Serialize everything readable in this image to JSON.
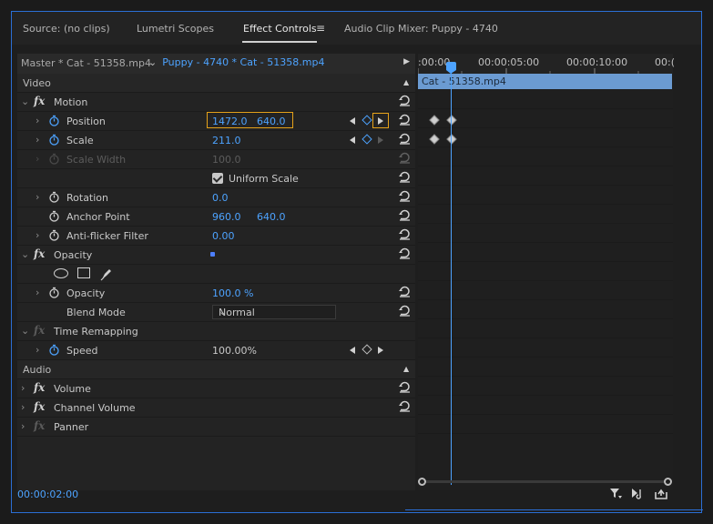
{
  "tabs": [
    {
      "label": "Source: (no clips)",
      "active": false
    },
    {
      "label": "Lumetri Scopes",
      "active": false
    },
    {
      "label": "Effect Controls",
      "active": true
    },
    {
      "label": "Audio Clip Mixer: Puppy - 4740",
      "active": false
    }
  ],
  "menu_icon": "≡",
  "clip_header": {
    "master": "Master * Cat - 51358.mp4",
    "selected": "Puppy - 4740 * Cat - 51358.mp4"
  },
  "sections": {
    "video": "Video",
    "audio": "Audio"
  },
  "effects": {
    "motion": "Motion",
    "position": {
      "label": "Position",
      "x": "1472.0",
      "y": "640.0"
    },
    "scale": {
      "label": "Scale",
      "value": "211.0"
    },
    "scale_width": {
      "label": "Scale Width",
      "value": "100.0"
    },
    "uniform_scale": "Uniform Scale",
    "rotation": {
      "label": "Rotation",
      "value": "0.0"
    },
    "anchor": {
      "label": "Anchor Point",
      "x": "960.0",
      "y": "640.0"
    },
    "antiflicker": {
      "label": "Anti-flicker Filter",
      "value": "0.00"
    },
    "opacity_fx": "Opacity",
    "opacity": {
      "label": "Opacity",
      "value": "100.0 %"
    },
    "blend": {
      "label": "Blend Mode",
      "value": "Normal"
    },
    "time_remap": "Time Remapping",
    "speed": {
      "label": "Speed",
      "value": "100.00%"
    },
    "volume": "Volume",
    "channel_volume": "Channel Volume",
    "panner": "Panner"
  },
  "timeline": {
    "ticks": [
      ":00:00",
      "00:00:05:00",
      "00:00:10:00",
      "00:("
    ],
    "clip": "Cat - 51358.mp4"
  },
  "timecode": "00:00:02:00",
  "colors": {
    "accent": "#4da3ff",
    "highlight": "#e5a21a",
    "clipbar": "#6b9bd2"
  }
}
